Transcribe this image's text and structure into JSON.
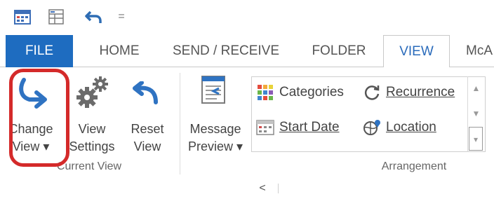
{
  "qat": {
    "icons": [
      "calendar-icon",
      "grid-icon",
      "undo-icon",
      "customize-icon"
    ],
    "customize_glyph": "="
  },
  "tabs": {
    "file": "FILE",
    "home": "HOME",
    "send_receive": "SEND / RECEIVE",
    "folder": "FOLDER",
    "view": "VIEW",
    "more": "McA"
  },
  "ribbon": {
    "current_view": {
      "group_label": "Current View",
      "change_view": [
        "Change",
        "View ▾"
      ],
      "view_settings": [
        "View",
        "Settings"
      ],
      "reset_view": [
        "Reset",
        "View"
      ]
    },
    "message_preview": [
      "Message",
      "Preview ▾"
    ],
    "arrangement": {
      "group_label": "Arrangement",
      "categories": "Categories",
      "recurrence": "Recurrence",
      "start_date": "Start Date",
      "location": "Location"
    }
  },
  "bottom": {
    "collapse_glyph": "<"
  },
  "colors": {
    "accent": "#1e6cc0",
    "highlight": "#d42a2a"
  }
}
